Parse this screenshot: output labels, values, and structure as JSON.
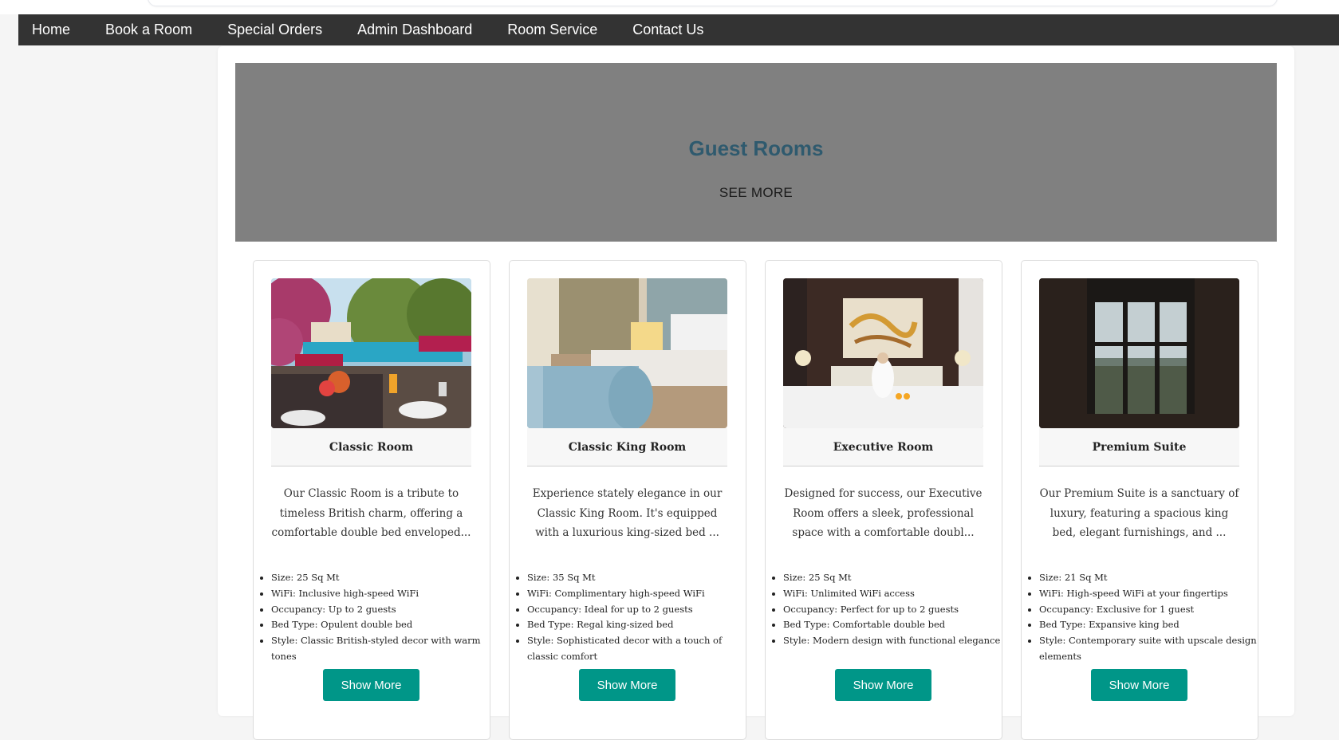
{
  "nav": {
    "items": [
      {
        "label": "Home"
      },
      {
        "label": "Book a Room"
      },
      {
        "label": "Special Orders"
      },
      {
        "label": "Admin Dashboard"
      },
      {
        "label": "Room Service"
      },
      {
        "label": "Contact Us"
      }
    ]
  },
  "hero": {
    "title": "Guest Rooms",
    "see_more": "SEE MORE"
  },
  "rooms": [
    {
      "title": "Classic Room",
      "description": "Our Classic Room is a tribute to timeless British charm, offering a comfortable double bed enveloped...",
      "features": [
        "Size: 25 Sq Mt",
        "WiFi: Inclusive high-speed WiFi",
        "Occupancy: Up to 2 guests",
        "Bed Type: Opulent double bed",
        "Style: Classic British-styled decor with warm tones"
      ],
      "button": "Show More",
      "image_icon": "poolside-breakfast-photo"
    },
    {
      "title": "Classic King Room",
      "description": "Experience stately elegance in our Classic King Room. It's equipped with a luxurious king-sized bed ...",
      "features": [
        "Size: 35 Sq Mt",
        "WiFi: Complimentary high-speed WiFi",
        "Occupancy: Ideal for up to 2 guests",
        "Bed Type: Regal king-sized bed",
        "Style: Sophisticated decor with a touch of classic comfort"
      ],
      "button": "Show More",
      "image_icon": "king-bed-photo"
    },
    {
      "title": "Executive Room",
      "description": "Designed for success, our Executive Room offers a sleek, professional space with a comfortable doubl...",
      "features": [
        "Size: 25 Sq Mt",
        "WiFi: Unlimited WiFi access",
        "Occupancy: Perfect for up to 2 guests",
        "Bed Type: Comfortable double bed",
        "Style: Modern design with functional elegance"
      ],
      "button": "Show More",
      "image_icon": "executive-bedroom-photo"
    },
    {
      "title": "Premium Suite",
      "description": "Our Premium Suite is a sanctuary of luxury, featuring a spacious king bed, elegant furnishings, and ...",
      "features": [
        "Size: 21 Sq Mt",
        "WiFi: High-speed WiFi at your fingertips",
        "Occupancy: Exclusive for 1 guest",
        "Bed Type: Expansive king bed",
        "Style: Contemporary suite with upscale design elements"
      ],
      "button": "Show More",
      "image_icon": "suite-window-view-photo"
    }
  ],
  "colors": {
    "navbar": "#333333",
    "hero_bg": "#808080",
    "hero_title": "#2f5a6e",
    "button": "#009688"
  }
}
